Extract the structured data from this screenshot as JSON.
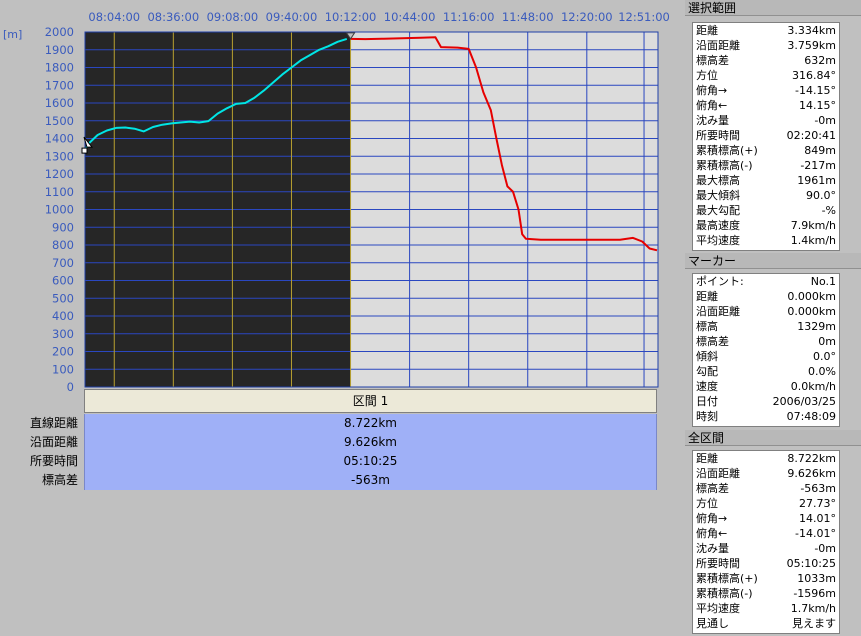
{
  "chart_data": {
    "type": "line",
    "title": "",
    "unit_label": "[m]",
    "xlabel": "",
    "ylabel": "[m]",
    "ylim": [
      0,
      2000
    ],
    "y_ticks": [
      "2000",
      "1900",
      "1800",
      "1700",
      "1600",
      "1500",
      "1400",
      "1300",
      "1200",
      "1100",
      "1000",
      "900",
      "800",
      "700",
      "600",
      "500",
      "400",
      "300",
      "200",
      "100",
      "0"
    ],
    "x_ticks": [
      "08:04:00",
      "08:36:00",
      "09:08:00",
      "09:40:00",
      "10:12:00",
      "10:44:00",
      "11:16:00",
      "11:48:00",
      "12:20:00",
      "12:51:00"
    ],
    "x_domain": [
      "07:48:09",
      "12:58:34"
    ],
    "grid": true,
    "selected_range": [
      "07:48:09",
      "10:12:00"
    ],
    "series": [
      {
        "color": "#00e5e5",
        "points": [
          [
            "07:48:09",
            1329
          ],
          [
            "07:50:00",
            1370
          ],
          [
            "07:55:00",
            1420
          ],
          [
            "08:00:00",
            1445
          ],
          [
            "08:05:00",
            1460
          ],
          [
            "08:10:00",
            1462
          ],
          [
            "08:15:00",
            1455
          ],
          [
            "08:20:00",
            1440
          ],
          [
            "08:25:00",
            1465
          ],
          [
            "08:30:00",
            1478
          ],
          [
            "08:35:00",
            1485
          ],
          [
            "08:40:00",
            1490
          ],
          [
            "08:45:00",
            1495
          ],
          [
            "08:50:00",
            1490
          ],
          [
            "08:55:00",
            1498
          ],
          [
            "09:00:00",
            1540
          ],
          [
            "09:05:00",
            1570
          ],
          [
            "09:10:00",
            1595
          ],
          [
            "09:15:00",
            1600
          ],
          [
            "09:20:00",
            1630
          ],
          [
            "09:25:00",
            1670
          ],
          [
            "09:30:00",
            1715
          ],
          [
            "09:35:00",
            1760
          ],
          [
            "09:40:00",
            1800
          ],
          [
            "09:45:00",
            1840
          ],
          [
            "09:50:00",
            1870
          ],
          [
            "09:55:00",
            1900
          ],
          [
            "10:00:00",
            1920
          ],
          [
            "10:05:00",
            1945
          ],
          [
            "10:10:00",
            1961
          ]
        ]
      },
      {
        "color": "#e60000",
        "points": [
          [
            "10:12:00",
            1961
          ],
          [
            "10:20:00",
            1960
          ],
          [
            "10:30:00",
            1962
          ],
          [
            "10:40:00",
            1965
          ],
          [
            "10:50:00",
            1968
          ],
          [
            "10:58:00",
            1970
          ],
          [
            "11:01:00",
            1915
          ],
          [
            "11:10:00",
            1912
          ],
          [
            "11:16:00",
            1905
          ],
          [
            "11:20:00",
            1800
          ],
          [
            "11:24:00",
            1660
          ],
          [
            "11:28:00",
            1560
          ],
          [
            "11:31:00",
            1400
          ],
          [
            "11:34:00",
            1250
          ],
          [
            "11:37:00",
            1130
          ],
          [
            "11:40:00",
            1100
          ],
          [
            "11:43:00",
            1000
          ],
          [
            "11:45:00",
            860
          ],
          [
            "11:47:00",
            835
          ],
          [
            "11:55:00",
            830
          ],
          [
            "12:10:00",
            830
          ],
          [
            "12:25:00",
            830
          ],
          [
            "12:38:00",
            830
          ],
          [
            "12:45:00",
            840
          ],
          [
            "12:50:00",
            820
          ],
          [
            "12:54:00",
            780
          ],
          [
            "12:58:00",
            770
          ]
        ]
      }
    ]
  },
  "summary": {
    "header": "区間 1",
    "rows": [
      {
        "label": "直線距離",
        "value": "8.722km"
      },
      {
        "label": "沿面距離",
        "value": "9.626km"
      },
      {
        "label": "所要時間",
        "value": "05:10:25"
      },
      {
        "label": "標高差",
        "value": "-563m"
      }
    ]
  },
  "selection_panel": {
    "title": "選択範囲",
    "rows": [
      {
        "k": "距離",
        "v": "3.334km"
      },
      {
        "k": "沿面距離",
        "v": "3.759km"
      },
      {
        "k": "標高差",
        "v": "632m"
      },
      {
        "k": "方位",
        "v": "316.84°"
      },
      {
        "k": "俯角→",
        "v": "-14.15°"
      },
      {
        "k": "俯角←",
        "v": "14.15°"
      },
      {
        "k": "沈み量",
        "v": "-0m"
      },
      {
        "k": "所要時間",
        "v": "02:20:41"
      },
      {
        "k": "累積標高(+)",
        "v": "849m"
      },
      {
        "k": "累積標高(-)",
        "v": "-217m"
      },
      {
        "k": "最大標高",
        "v": "1961m"
      },
      {
        "k": "最大傾斜",
        "v": "90.0°"
      },
      {
        "k": "最大勾配",
        "v": "-%"
      },
      {
        "k": "最高速度",
        "v": "7.9km/h"
      },
      {
        "k": "平均速度",
        "v": "1.4km/h"
      }
    ]
  },
  "marker_panel": {
    "title": "マーカー",
    "rows": [
      {
        "k": "ポイント:",
        "v": "No.1"
      },
      {
        "k": "距離",
        "v": "0.000km"
      },
      {
        "k": "沿面距離",
        "v": "0.000km"
      },
      {
        "k": "標高",
        "v": "1329m"
      },
      {
        "k": "標高差",
        "v": "0m"
      },
      {
        "k": "傾斜",
        "v": "0.0°"
      },
      {
        "k": "勾配",
        "v": "0.0%"
      },
      {
        "k": "速度",
        "v": "0.0km/h"
      },
      {
        "k": "日付",
        "v": "2006/03/25"
      },
      {
        "k": "時刻",
        "v": "07:48:09"
      }
    ]
  },
  "total_panel": {
    "title": "全区間",
    "rows": [
      {
        "k": "距離",
        "v": "8.722km"
      },
      {
        "k": "沿面距離",
        "v": "9.626km"
      },
      {
        "k": "標高差",
        "v": "-563m"
      },
      {
        "k": "方位",
        "v": "27.73°"
      },
      {
        "k": "俯角→",
        "v": "14.01°"
      },
      {
        "k": "俯角←",
        "v": "-14.01°"
      },
      {
        "k": "沈み量",
        "v": "-0m"
      },
      {
        "k": "所要時間",
        "v": "05:10:25"
      },
      {
        "k": "累積標高(+)",
        "v": "1033m"
      },
      {
        "k": "累積標高(-)",
        "v": "-1596m"
      },
      {
        "k": "平均速度",
        "v": "1.7km/h"
      },
      {
        "k": "見通し",
        "v": "見えます"
      }
    ]
  }
}
